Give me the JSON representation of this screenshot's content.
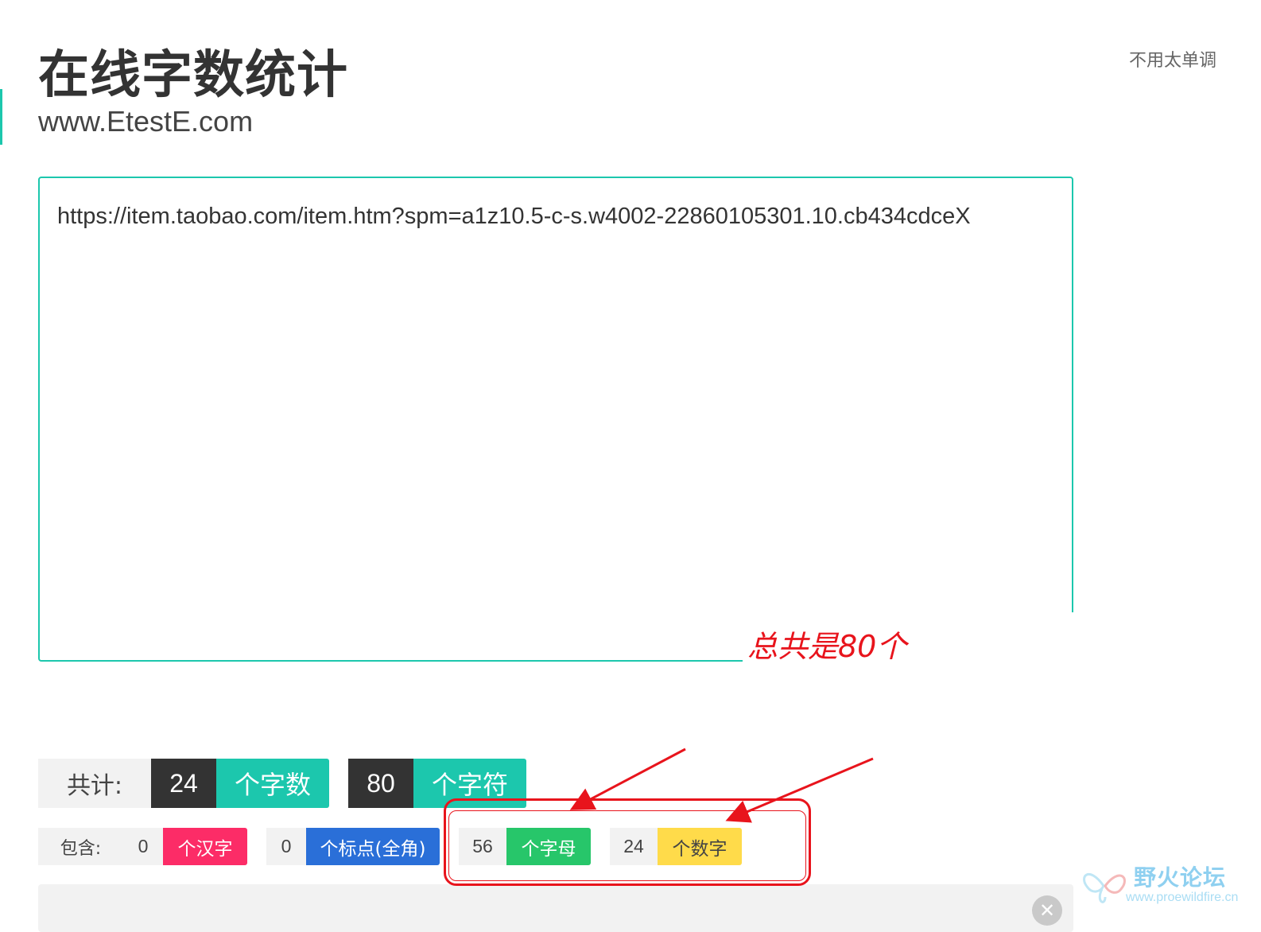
{
  "header": {
    "title": "在线字数统计",
    "url": "www.EtestE.com",
    "top_link": "不用太单调"
  },
  "editor": {
    "content": "https://item.taobao.com/item.htm?spm=a1z10.5-c-s.w4002-22860105301.10.cb434cdceX"
  },
  "annotation": {
    "text": "总共是80个"
  },
  "totals": {
    "label": "共计:",
    "words": {
      "value": "24",
      "label": "个字数"
    },
    "chars": {
      "value": "80",
      "label": "个字符"
    }
  },
  "breakdown": {
    "label": "包含:",
    "items": [
      {
        "value": "0",
        "label": "个汉字",
        "color": "#fc2c67"
      },
      {
        "value": "0",
        "label": "个标点(全角)",
        "color": "#2a6fd8"
      },
      {
        "value": "56",
        "label": "个字母",
        "color": "#27c66a"
      },
      {
        "value": "24",
        "label": "个数字",
        "color": "#ffdb4a"
      }
    ]
  },
  "watermark": {
    "title": "野火论坛",
    "url": "www.proewildfire.cn"
  },
  "colors": {
    "accent": "#1cc7ad",
    "annotation_red": "#e8141c"
  },
  "icons": {
    "clear": "close-icon",
    "watermark_logo": "butterfly-logo-icon"
  }
}
